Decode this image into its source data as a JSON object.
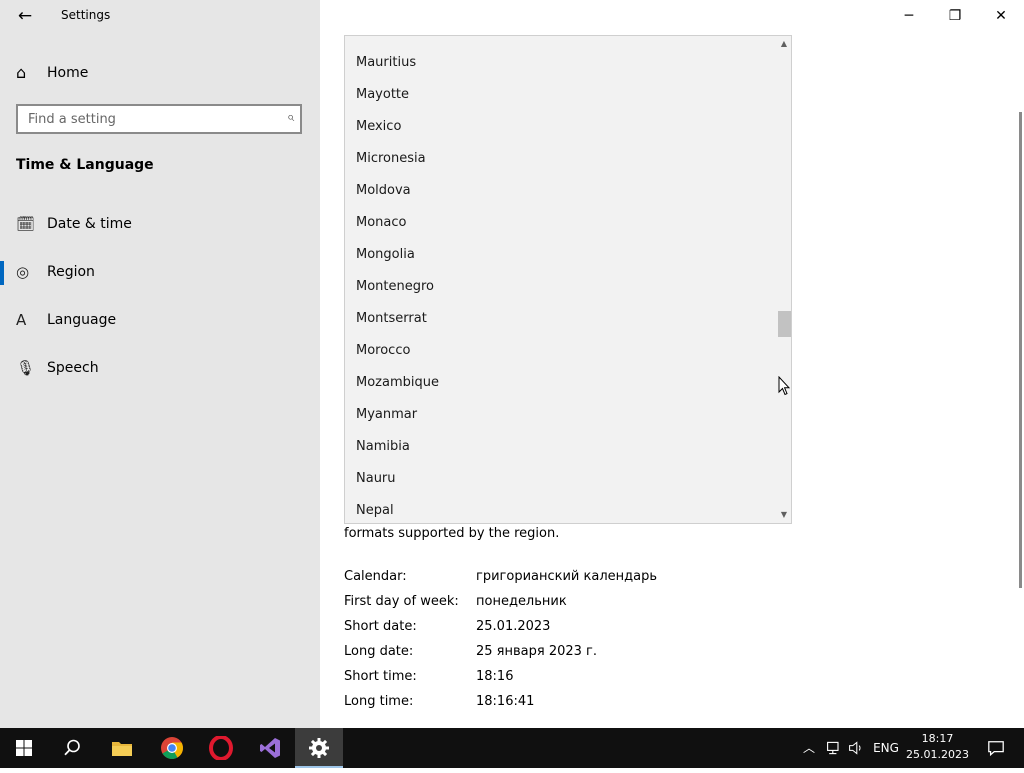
{
  "window": {
    "title": "Settings",
    "back_icon": "←",
    "minimize_icon": "─",
    "restore_icon": "❐",
    "close_icon": "✕"
  },
  "sidebar": {
    "home_label": "Home",
    "home_icon": "⌂",
    "search_placeholder": "Find a setting",
    "search_icon": "⌕",
    "section_title": "Time & Language",
    "items": [
      {
        "label": "Date & time",
        "icon": "🗓",
        "selected": false
      },
      {
        "label": "Region",
        "icon": "◎",
        "selected": true
      },
      {
        "label": "Language",
        "icon": "A",
        "selected": false
      },
      {
        "label": "Speech",
        "icon": "🎙",
        "selected": false
      }
    ]
  },
  "country_dropdown": {
    "options": [
      "Mauritius",
      "Mayotte",
      "Mexico",
      "Micronesia",
      "Moldova",
      "Monaco",
      "Mongolia",
      "Montenegro",
      "Montserrat",
      "Morocco",
      "Mozambique",
      "Myanmar",
      "Namibia",
      "Nauru",
      "Nepal"
    ],
    "scroll_up_icon": "▲",
    "scroll_down_icon": "▼"
  },
  "region_formats": {
    "partial_text": "formats supported by the region.",
    "rows": [
      {
        "key": "Calendar:",
        "value": "григорианский календарь"
      },
      {
        "key": "First day of week:",
        "value": "понедельник"
      },
      {
        "key": "Short date:",
        "value": "25.01.2023"
      },
      {
        "key": "Long date:",
        "value": "25 января 2023 г."
      },
      {
        "key": "Short time:",
        "value": "18:16"
      },
      {
        "key": "Long time:",
        "value": "18:16:41"
      }
    ]
  },
  "taskbar": {
    "tray_chevron": "︿",
    "language": "ENG",
    "time": "18:17",
    "date": "25.01.2023",
    "colors": {
      "background": "#101010",
      "accent": "#0067c0"
    }
  }
}
